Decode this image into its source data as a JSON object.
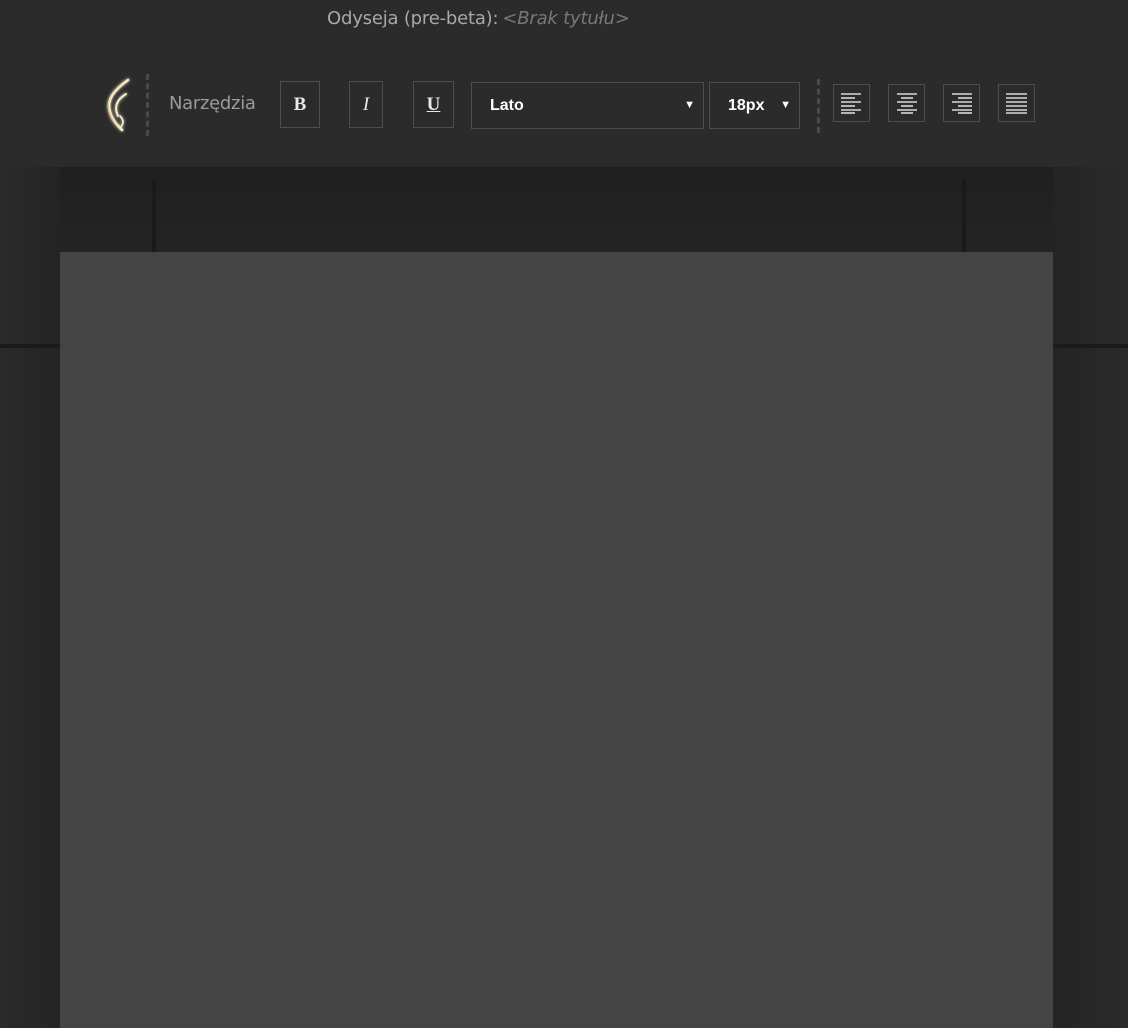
{
  "header": {
    "app_name": "Odyseja (pre-beta):",
    "document_title": "<Brak tytułu>"
  },
  "toolbar": {
    "tools_label": "Narzędzia",
    "bold_label": "B",
    "italic_label": "I",
    "underline_label": "U",
    "font_family": "Lato",
    "font_size": "18px"
  },
  "icons": {
    "logo": "flame-feather-logo",
    "align_left": "align-left-icon",
    "align_center": "align-center-icon",
    "align_right": "align-right-icon",
    "align_justify": "align-justify-icon"
  },
  "colors": {
    "background": "#222222",
    "toolbar": "#2b2b2b",
    "page": "#444444",
    "logo_glow": "#f3d9a0"
  }
}
